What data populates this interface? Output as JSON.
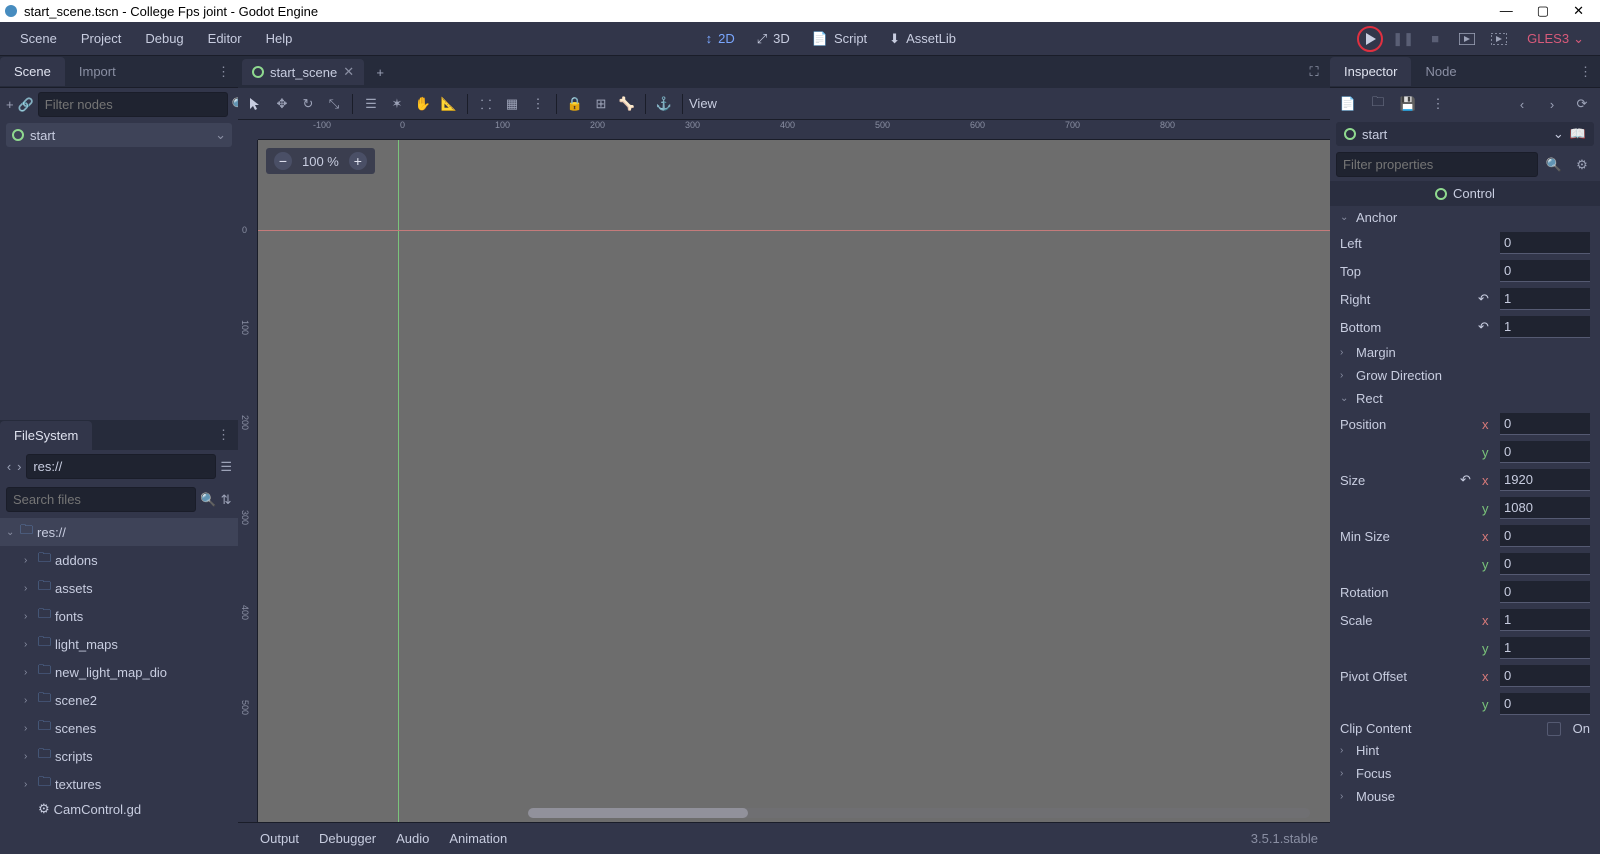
{
  "title": "start_scene.tscn - College Fps joint - Godot Engine",
  "menu": [
    "Scene",
    "Project",
    "Debug",
    "Editor",
    "Help"
  ],
  "modes": {
    "d2": "2D",
    "d3": "3D",
    "script": "Script",
    "assetlib": "AssetLib"
  },
  "renderer": "GLES3",
  "left_tabs": {
    "scene": "Scene",
    "import": "Import"
  },
  "scene_filter_placeholder": "Filter nodes",
  "root_node": "start",
  "filesystem": {
    "title": "FileSystem",
    "path": "res://",
    "search_placeholder": "Search files",
    "root": "res://",
    "folders": [
      "addons",
      "assets",
      "fonts",
      "light_maps",
      "new_light_map_dio",
      "scene2",
      "scenes",
      "scripts",
      "textures"
    ],
    "files": [
      "CamControl.gd"
    ]
  },
  "scene_tab": "start_scene",
  "zoom": "100 %",
  "view_label": "View",
  "ruler_h_ticks": [
    "-100",
    "0",
    "100",
    "200",
    "300",
    "400",
    "500",
    "600",
    "700",
    "800"
  ],
  "ruler_v_ticks": [
    "0",
    "100",
    "200",
    "300",
    "400",
    "500"
  ],
  "bottom_tabs": [
    "Output",
    "Debugger",
    "Audio",
    "Animation"
  ],
  "version": "3.5.1.stable",
  "right_tabs": {
    "inspector": "Inspector",
    "node": "Node"
  },
  "inspector": {
    "node": "start",
    "filter_placeholder": "Filter properties",
    "class": "Control",
    "anchor": {
      "title": "Anchor",
      "left_l": "Left",
      "left": "0",
      "top_l": "Top",
      "top": "0",
      "right_l": "Right",
      "right": "1",
      "bottom_l": "Bottom",
      "bottom": "1"
    },
    "margin_title": "Margin",
    "grow_title": "Grow Direction",
    "rect": {
      "title": "Rect",
      "position_l": "Position",
      "pos_x": "0",
      "pos_y": "0",
      "size_l": "Size",
      "size_x": "1920",
      "size_y": "1080",
      "minsize_l": "Min Size",
      "min_x": "0",
      "min_y": "0",
      "rotation_l": "Rotation",
      "rotation": "0",
      "scale_l": "Scale",
      "scale_x": "1",
      "scale_y": "1",
      "pivot_l": "Pivot Offset",
      "pivot_x": "0",
      "pivot_y": "0",
      "clip_l": "Clip Content",
      "clip_on": "On"
    },
    "hint_title": "Hint",
    "focus_title": "Focus",
    "mouse_title": "Mouse"
  }
}
